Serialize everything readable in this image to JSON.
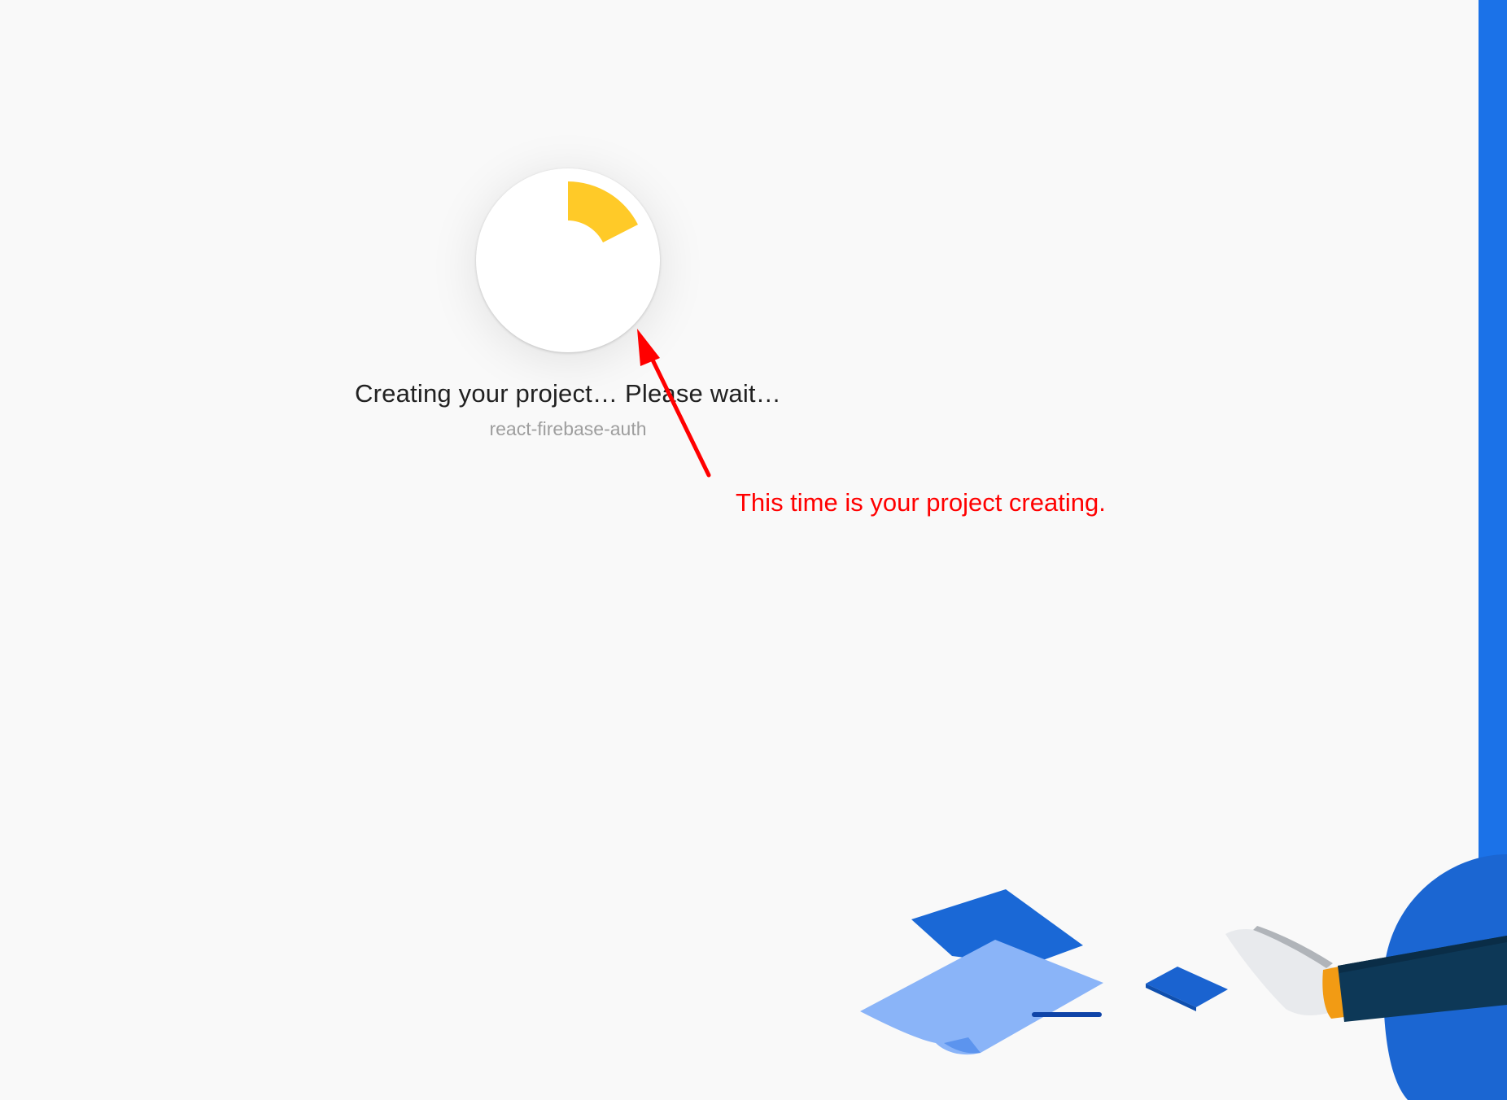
{
  "status": {
    "title": "Creating your project… Please wait…",
    "project_name": "react-firebase-auth",
    "spinner_color": "#ffca28"
  },
  "annotation": {
    "text": "This time is your project creating.",
    "color": "#ff0000"
  },
  "theme": {
    "background": "#f9f9f9",
    "accent": "#1b72e8"
  }
}
